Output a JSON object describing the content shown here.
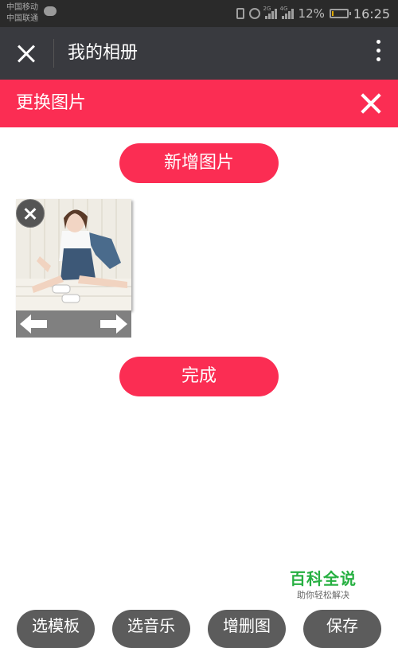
{
  "status_bar": {
    "carrier_1": "中国移动",
    "carrier_2": "中国联通",
    "network_1": "2G",
    "network_2": "4G",
    "battery_percent": "12%",
    "battery_level": 0.12,
    "time": "16:25",
    "icons": [
      "wechat-icon",
      "vibrate-icon",
      "alarm-icon",
      "signal-icon",
      "battery-icon"
    ]
  },
  "title_bar": {
    "title": "我的相册",
    "close_icon": "close-icon",
    "more_icon": "more-vertical-icon"
  },
  "panel": {
    "title": "更换图片",
    "close_icon": "close-icon",
    "add_button": "新增图片",
    "done_button": "完成",
    "photos": [
      {
        "remove_icon": "remove-icon",
        "prev_icon": "arrow-left-icon",
        "next_icon": "arrow-right-icon"
      }
    ]
  },
  "watermark": {
    "title": "百科全说",
    "subtitle": "助你轻松解决"
  },
  "toolbar": {
    "buttons": [
      "选模板",
      "选音乐",
      "增删图",
      "保存"
    ]
  },
  "colors": {
    "accent": "#fb2d53",
    "title_bar": "#393a3f",
    "status_bar": "#2a2a2a",
    "toolbar_button": "#5c5c5c",
    "watermark": "#27b042"
  }
}
